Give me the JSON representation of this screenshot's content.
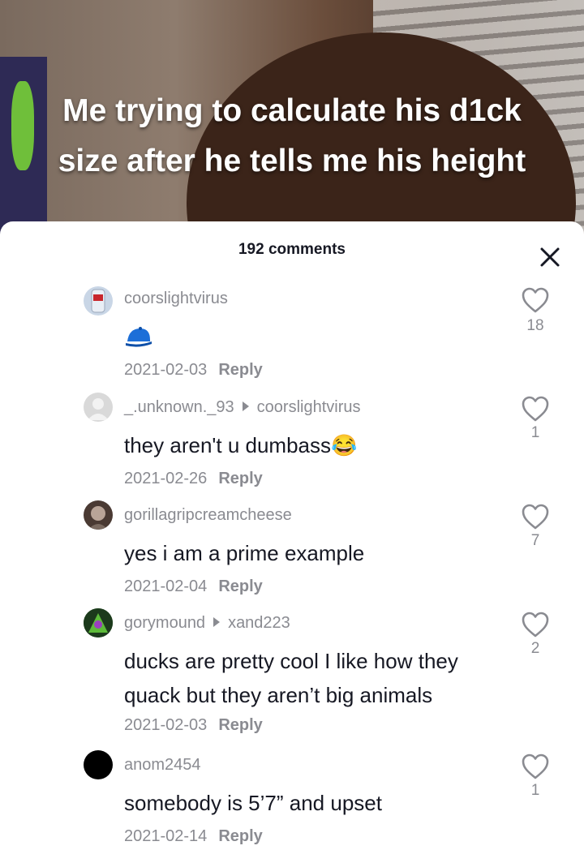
{
  "video": {
    "caption": "Me trying to calculate his d1ck size after he tells me his height"
  },
  "panel": {
    "comment_count": "192 comments"
  },
  "comments": [
    {
      "username": "coorslightvirus",
      "reply_to": "",
      "text": "🧢",
      "date": "2021-02-03",
      "reply_label": "Reply",
      "likes": "18",
      "avatar_color": "#c9d6e6"
    },
    {
      "username": "_.unknown._93",
      "reply_to": "coorslightvirus",
      "text": "they aren't u dumbass😂",
      "date": "2021-02-26",
      "reply_label": "Reply",
      "likes": "1",
      "avatar_color": "#d9d9d9"
    },
    {
      "username": "gorillagripcreamcheese",
      "reply_to": "",
      "text": "yes i am a prime example",
      "date": "2021-02-04",
      "reply_label": "Reply",
      "likes": "7",
      "avatar_color": "#4a3a33"
    },
    {
      "username": "gorymound",
      "reply_to": "xand223",
      "text": "ducks are pretty cool I like how they quack but they aren’t big animals",
      "date": "2021-02-03",
      "reply_label": "Reply",
      "likes": "2",
      "avatar_color": "#2f6a2a"
    },
    {
      "username": "anom2454",
      "reply_to": "",
      "text": "somebody is 5’7” and upset",
      "date": "2021-02-14",
      "reply_label": "Reply",
      "likes": "1",
      "avatar_color": "#000000"
    }
  ]
}
